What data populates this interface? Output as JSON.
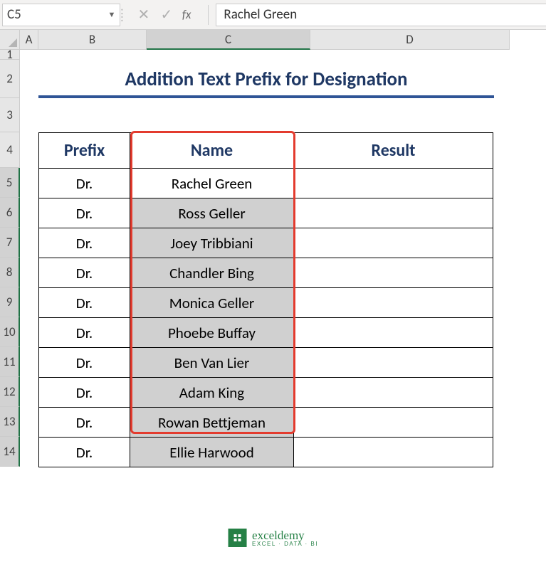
{
  "nameBox": "C5",
  "formulaValue": "Rachel Green",
  "fx": "fx",
  "columns": [
    "A",
    "B",
    "C",
    "D"
  ],
  "rowNums": [
    "1",
    "2",
    "3",
    "4",
    "5",
    "6",
    "7",
    "8",
    "9",
    "10",
    "11",
    "12",
    "13",
    "14"
  ],
  "title": "Addition Text Prefix for Designation",
  "headers": {
    "prefix": "Prefix",
    "name": "Name",
    "result": "Result"
  },
  "rows": [
    {
      "prefix": "Dr.",
      "name": "Rachel Green",
      "result": ""
    },
    {
      "prefix": "Dr.",
      "name": "Ross Geller",
      "result": ""
    },
    {
      "prefix": "Dr.",
      "name": "Joey Tribbiani",
      "result": ""
    },
    {
      "prefix": "Dr.",
      "name": "Chandler Bing",
      "result": ""
    },
    {
      "prefix": "Dr.",
      "name": "Monica Geller",
      "result": ""
    },
    {
      "prefix": "Dr.",
      "name": "Phoebe Buffay",
      "result": ""
    },
    {
      "prefix": "Dr.",
      "name": "Ben Van Lier",
      "result": ""
    },
    {
      "prefix": "Dr.",
      "name": "Adam King",
      "result": ""
    },
    {
      "prefix": "Dr.",
      "name": "Rowan Bettjeman",
      "result": ""
    },
    {
      "prefix": "Dr.",
      "name": "Ellie Harwood",
      "result": ""
    }
  ],
  "selection": {
    "activeCol": "C",
    "firstRow": 5,
    "lastRow": 14
  },
  "watermark": {
    "main": "exceldemy",
    "sub": "EXCEL · DATA · BI"
  }
}
